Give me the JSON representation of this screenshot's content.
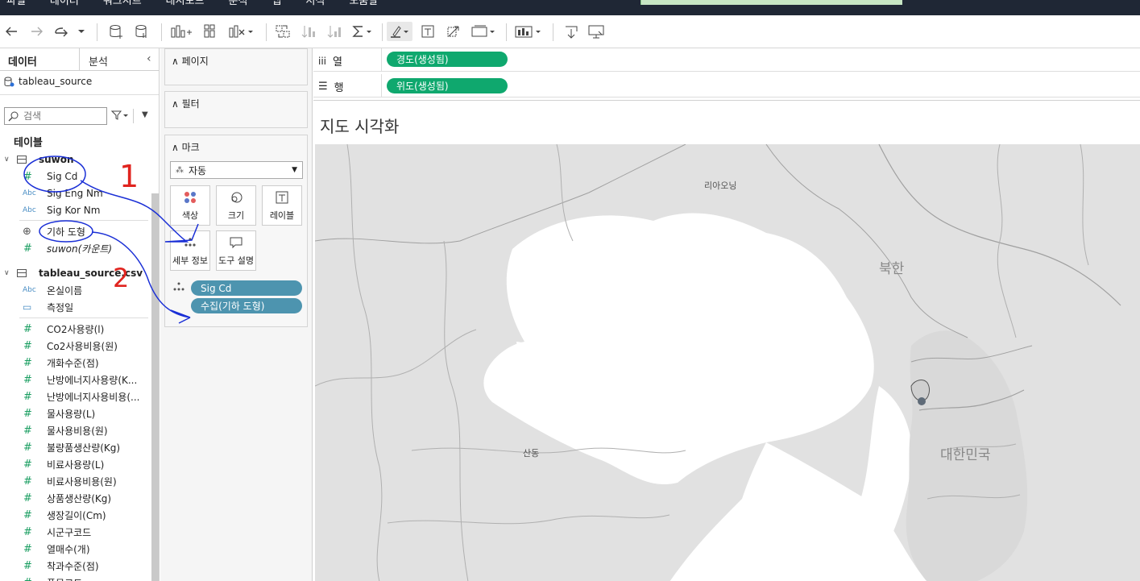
{
  "menu": [
    "파일",
    "데이터",
    "워크시트",
    "대시보드",
    "분석",
    "맵",
    "서식",
    "도움말"
  ],
  "data_pane": {
    "tab_data": "데이터",
    "tab_analysis": "분석",
    "source_name": "tableau_source",
    "search_placeholder": "검색",
    "tables_heading": "테이블",
    "tables": [
      {
        "name": "suwon",
        "fields": [
          {
            "type": "Abc",
            "name": "Sig Cd"
          },
          {
            "type": "Abc",
            "name": "Sig Eng Nm"
          },
          {
            "type": "Abc",
            "name": "Sig Kor Nm"
          },
          {
            "type": "geo",
            "name": "기하 도형"
          },
          {
            "type": "num",
            "name": "suwon(카운트)"
          }
        ]
      },
      {
        "name": "tableau_source.csv",
        "fields": [
          {
            "type": "Abc",
            "name": "온실이름"
          },
          {
            "type": "date",
            "name": "측정일"
          },
          {
            "type": "num",
            "name": "CO2사용량(l)"
          },
          {
            "type": "num",
            "name": "Co2사용비용(원)"
          },
          {
            "type": "num",
            "name": "개화수준(점)"
          },
          {
            "type": "num",
            "name": "난방에너지사용량(K..."
          },
          {
            "type": "num",
            "name": "난방에너지사용비용(..."
          },
          {
            "type": "num",
            "name": "물사용량(L)"
          },
          {
            "type": "num",
            "name": "물사용비용(원)"
          },
          {
            "type": "num",
            "name": "불량품생산량(Kg)"
          },
          {
            "type": "num",
            "name": "비료사용량(L)"
          },
          {
            "type": "num",
            "name": "비료사용비용(원)"
          },
          {
            "type": "num",
            "name": "상품생산량(Kg)"
          },
          {
            "type": "num",
            "name": "생장길이(Cm)"
          },
          {
            "type": "num",
            "name": "시군구코드"
          },
          {
            "type": "num",
            "name": "열매수(개)"
          },
          {
            "type": "num",
            "name": "착과수준(점)"
          },
          {
            "type": "num",
            "name": "품목코드"
          }
        ]
      }
    ]
  },
  "cards": {
    "pages": "페이지",
    "filters": "필터",
    "marks": "마크",
    "mark_type": "자동",
    "mark_buttons": [
      "색상",
      "크기",
      "레이블",
      "세부 정보",
      "도구 설명"
    ],
    "detail_pills": [
      "Sig Cd",
      "수집(기하 도형)"
    ]
  },
  "shelves": {
    "columns_label": "열",
    "columns_pill": "경도(생성됨)",
    "rows_label": "행",
    "rows_pill": "위도(생성됨)"
  },
  "view": {
    "title": "지도 시각화",
    "map_labels": [
      "리아오닝",
      "북한",
      "산동",
      "대한민국"
    ]
  },
  "annotations": [
    "1",
    "2"
  ],
  "colors": {
    "menubar": "#1f2735",
    "pill_detail": "#4d94af",
    "pill_shelf": "#0fa86e",
    "annotation_blue": "#1a2fd6",
    "annotation_red": "#e0241f"
  }
}
